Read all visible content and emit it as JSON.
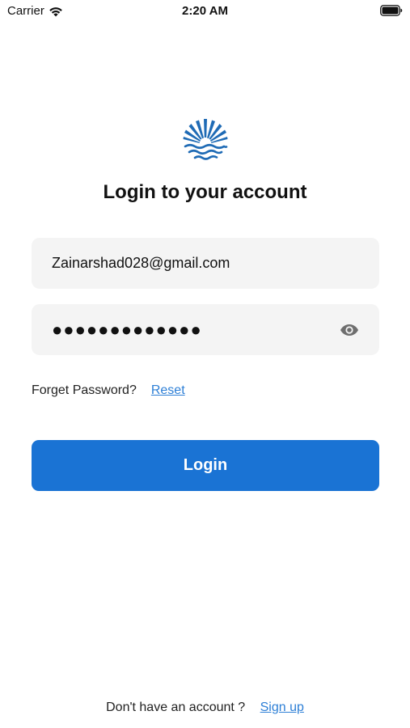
{
  "status_bar": {
    "carrier": "Carrier",
    "time": "2:20 AM",
    "wifi_icon": "wifi-icon",
    "battery_icon": "battery-icon"
  },
  "logo": {
    "icon": "sun-over-waves-logo",
    "color": "#1f6bb5"
  },
  "title": "Login to your account",
  "email": {
    "value": "Zainarshad028@gmail.com",
    "placeholder": ""
  },
  "password": {
    "value": "●●●●●●●●●●●●●",
    "toggle_icon": "eye-icon"
  },
  "forgot": {
    "label": "Forget Password?",
    "reset_link": "Reset"
  },
  "login_button": "Login",
  "signup": {
    "label": "Don't have an account ?",
    "link": "Sign up"
  },
  "colors": {
    "primary": "#1a73d4",
    "link": "#2d7fd6",
    "field_bg": "#f4f4f4"
  }
}
